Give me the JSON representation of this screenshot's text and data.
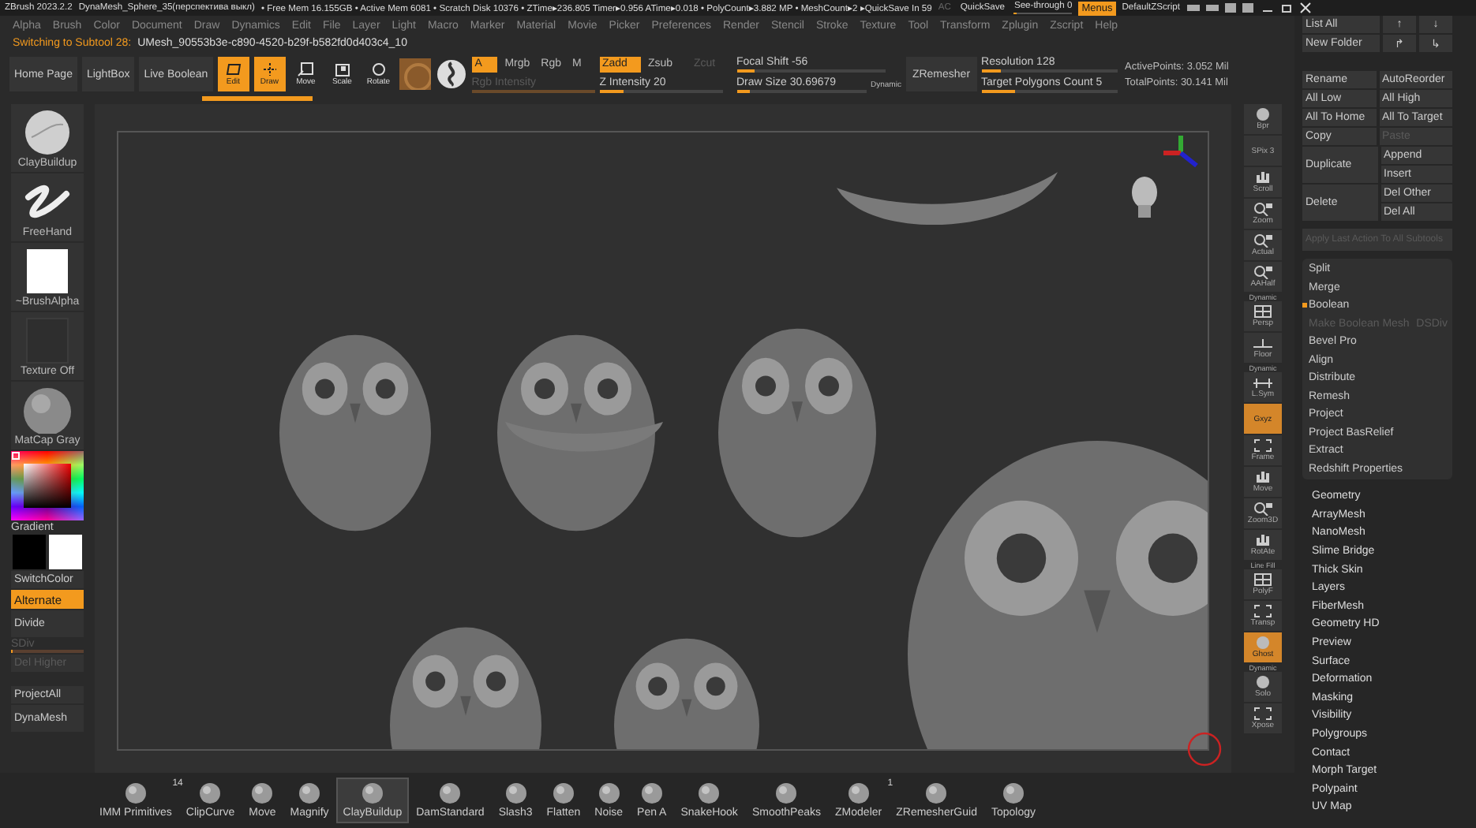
{
  "title_bar": {
    "app": "ZBrush 2023.2.2",
    "document": "DynaMesh_Sphere_35(перспектива выкл)",
    "stats": "• Free Mem 16.155GB • Active Mem 6081 • Scratch Disk 10376 • ZTime▸236.805 Timer▸0.956 ATime▸0.018 • PolyCount▸3.882 MP • MeshCount▸2 ▸QuickSave In 59",
    "autosave": "AC",
    "quicksave": "QuickSave",
    "see_through": {
      "label": "See-through  0",
      "level": 0
    },
    "menus": {
      "label": "Menus",
      "on": true
    },
    "script": "DefaultZScript"
  },
  "menu_bar": [
    "Alpha",
    "Brush",
    "Color",
    "Document",
    "Draw",
    "Dynamics",
    "Edit",
    "File",
    "Layer",
    "Light",
    "Macro",
    "Marker",
    "Material",
    "Movie",
    "Picker",
    "Preferences",
    "Render",
    "Stencil",
    "Stroke",
    "Texture",
    "Tool",
    "Transform",
    "Zplugin",
    "Zscript",
    "Help"
  ],
  "status": {
    "prefix": "Switching to Subtool 28:",
    "mesh": "UMesh_90553b3e-c890-4520-b29f-b582fd0d403c4_10"
  },
  "toolbar": {
    "nav": [
      "Home Page",
      "LightBox",
      "Live Boolean"
    ],
    "transform": [
      {
        "label": "Edit",
        "kind": "edit",
        "on": true
      },
      {
        "label": "Draw",
        "kind": "draw",
        "on": true
      },
      {
        "label": "Move",
        "kind": "move",
        "on": false
      },
      {
        "label": "Scale",
        "kind": "scale",
        "on": false
      },
      {
        "label": "Rotate",
        "kind": "rotate",
        "on": false
      }
    ],
    "channels": [
      {
        "label": "A",
        "on": true
      },
      {
        "label": "Mrgb",
        "on": false
      },
      {
        "label": "Rgb",
        "on": false
      },
      {
        "label": "M",
        "on": false
      }
    ],
    "sculpt_modes": [
      {
        "label": "Zadd",
        "on": true,
        "disabled": false
      },
      {
        "label": "Zsub",
        "on": false,
        "disabled": false
      },
      {
        "label": "Zcut",
        "on": false,
        "disabled": true
      }
    ],
    "rgb_intensity": {
      "label": "Rgb Intensity",
      "level": 1,
      "disabled": true
    },
    "z_intensity": {
      "label": "Z Intensity 20",
      "level": 0.2,
      "disabled": false
    },
    "focal_shift": {
      "label": "Focal Shift -56",
      "level": 0.12
    },
    "draw_size": {
      "label": "Draw Size 30.69679",
      "level": 0.1
    },
    "dynamic": "Dynamic",
    "zremesher": "ZRemesher",
    "resolution": {
      "label": "Resolution 128",
      "level": 0.14
    },
    "target_polygons": {
      "label": "Target Polygons Count 5",
      "level": 0.25
    },
    "active_points": "ActivePoints: 3.052 Mil",
    "total_points": "TotalPoints: 30.141 Mil"
  },
  "left_panel": {
    "thumbnails": [
      {
        "label": "ClayBuildup",
        "kind": "brush"
      },
      {
        "label": "FreeHand",
        "kind": "stroke"
      },
      {
        "label": "~BrushAlpha",
        "kind": "alpha"
      },
      {
        "label": "Texture Off",
        "kind": "texture"
      },
      {
        "label": "MatCap Gray",
        "kind": "material"
      }
    ],
    "gradient": "Gradient",
    "switch_color": "SwitchColor",
    "alternate": {
      "label": "Alternate",
      "on": true
    },
    "divide": "Divide",
    "sdiv": {
      "label": "SDiv",
      "level": 0,
      "disabled": true
    },
    "del_higher": {
      "label": "Del Higher",
      "disabled": true
    },
    "project_all": "ProjectAll",
    "dynamesh": "DynaMesh"
  },
  "right_shelf": [
    {
      "label": "Bpr",
      "kind": "sphere",
      "on": false
    },
    {
      "label": "SPix 3",
      "kind": "slider",
      "on": false
    },
    {
      "label": "Scroll",
      "kind": "hand",
      "on": false
    },
    {
      "label": "Zoom",
      "kind": "zoom",
      "on": false
    },
    {
      "label": "Actual",
      "kind": "zoom",
      "on": false
    },
    {
      "label": "AAHalf",
      "kind": "zoom",
      "on": false
    },
    {
      "label": "Persp",
      "kind": "grid",
      "on": false,
      "heading": "Dynamic"
    },
    {
      "label": "Floor",
      "kind": "floor",
      "on": false
    },
    {
      "label": "L.Sym",
      "kind": "sym",
      "on": false,
      "heading": "Dynamic"
    },
    {
      "label": "Gxyz",
      "kind": "text",
      "on": true
    },
    {
      "label": "Frame",
      "kind": "frame",
      "on": false
    },
    {
      "label": "Move",
      "kind": "hand",
      "on": false
    },
    {
      "label": "Zoom3D",
      "kind": "zoom",
      "on": false
    },
    {
      "label": "RotAte",
      "kind": "hand",
      "on": false
    },
    {
      "label": "PolyF",
      "kind": "grid",
      "on": false,
      "heading": "Line Fill"
    },
    {
      "label": "Transp",
      "kind": "frame",
      "on": false
    },
    {
      "label": "Ghost",
      "kind": "ghost",
      "on": true
    },
    {
      "label": "Solo",
      "kind": "sphere",
      "on": false,
      "heading": "Dynamic"
    },
    {
      "label": "Xpose",
      "kind": "frame",
      "on": false
    }
  ],
  "subtool_panel": {
    "list_all": "List All",
    "new_folder": "New Folder",
    "arrows": [
      "↑",
      "↓",
      "↱",
      "↳"
    ],
    "pairs": [
      [
        "Rename",
        "AutoReorder"
      ],
      [
        "All Low",
        "All High"
      ],
      [
        "All To Home",
        "All To Target"
      ]
    ],
    "copy": {
      "label": "Copy"
    },
    "paste": {
      "label": "Paste",
      "disabled": true
    },
    "duplicate": "Duplicate",
    "append": "Append",
    "insert": "Insert",
    "delete": "Delete",
    "del_other": "Del Other",
    "del_all": "Del All",
    "apply_last": {
      "label": "Apply Last Action To All Subtools",
      "disabled": true
    },
    "actions": [
      {
        "label": "Split",
        "marked": false
      },
      {
        "label": "Merge",
        "marked": false
      },
      {
        "label": "Boolean",
        "marked": true
      }
    ],
    "make_boolean": {
      "label": "Make Boolean Mesh",
      "disabled": true
    },
    "dsdiv": "DSDiv",
    "more_actions": [
      "Bevel Pro",
      "Align",
      "Distribute",
      "Remesh",
      "Project",
      "Project BasRelief",
      "Extract",
      "Redshift Properties"
    ],
    "sections": [
      "Geometry",
      "ArrayMesh",
      "NanoMesh",
      "Slime Bridge",
      "Thick Skin",
      "Layers",
      "FiberMesh",
      "Geometry HD",
      "Preview",
      "Surface",
      "Deformation",
      "Masking",
      "Visibility",
      "Polygroups",
      "Contact",
      "Morph Target",
      "Polypaint",
      "UV Map"
    ]
  },
  "brush_shelf": [
    {
      "label": "IMM Primitives",
      "count": "14",
      "selected": false
    },
    {
      "label": "ClipCurve",
      "selected": false
    },
    {
      "label": "Move",
      "selected": false
    },
    {
      "label": "Magnify",
      "selected": false
    },
    {
      "label": "ClayBuildup",
      "selected": true
    },
    {
      "label": "DamStandard",
      "selected": false
    },
    {
      "label": "Slash3",
      "selected": false
    },
    {
      "label": "Flatten",
      "selected": false
    },
    {
      "label": "Noise",
      "selected": false
    },
    {
      "label": "Pen A",
      "selected": false
    },
    {
      "label": "SnakeHook",
      "selected": false
    },
    {
      "label": "SmoothPeaks",
      "selected": false
    },
    {
      "label": "ZModeler",
      "count": "1",
      "selected": false
    },
    {
      "label": "ZRemesherGuid",
      "selected": false
    },
    {
      "label": "Topology",
      "selected": false
    }
  ]
}
